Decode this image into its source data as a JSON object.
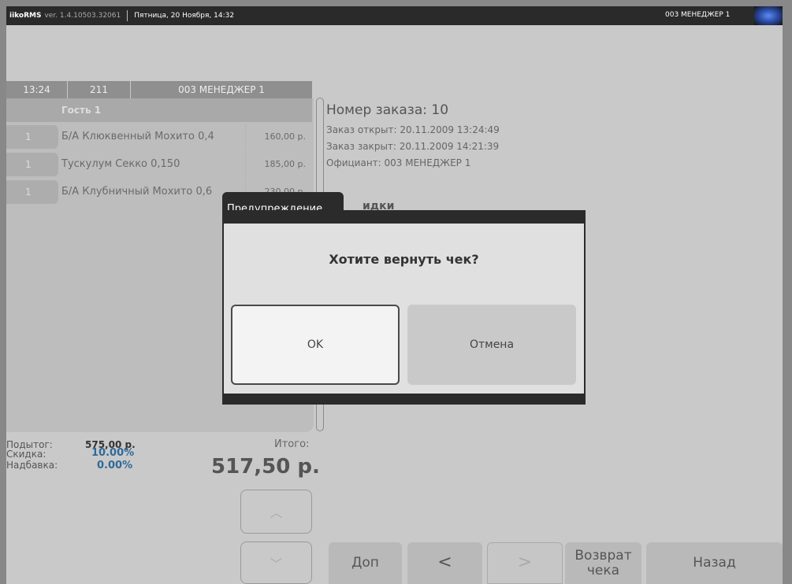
{
  "titlebar": {
    "brand": "iikoRMS",
    "version": "ver. 1.4.10503.32061",
    "datetime": "Пятница, 20 Ноября, 14:32",
    "user": "003 МЕНЕДЖЕР 1"
  },
  "order": {
    "time": "13:24",
    "table": "211",
    "waiter": "003 МЕНЕДЖЕР 1",
    "guest": "Гость 1",
    "items": [
      {
        "qty": "1",
        "name": "Б/А Клюквенный Мохито 0,4",
        "price": "160,00 р."
      },
      {
        "qty": "1",
        "name": "Тускулум Секко 0,150",
        "price": "185,00 р."
      },
      {
        "qty": "1",
        "name": "Б/А Клубничный Мохито 0,6",
        "price": "230,00 р."
      }
    ]
  },
  "info": {
    "title": "Номер заказа: 10",
    "opened": "Заказ открыт: 20.11.2009 13:24:49",
    "closed": "Заказ закрыт: 20.11.2009 14:21:39",
    "waiter": "Официант: 003 МЕНЕДЖЕР 1",
    "partial_text": "идки"
  },
  "totals": {
    "subtotal_label": "Подытог:",
    "subtotal_value": "575,00 р.",
    "discount_label": "Скидка:",
    "discount_value": "10.00%",
    "surcharge_label": "Надбавка:",
    "surcharge_value": "0.00%",
    "total_label": "Итого:",
    "total_value": "517,50 р."
  },
  "scroll": {
    "up": "︿",
    "down": "﹀"
  },
  "bottom": {
    "extra": "Доп",
    "prev": "<",
    "next": ">",
    "return_check": "Возврат чека",
    "back": "Назад"
  },
  "dialog": {
    "title": "Предупреждение",
    "message": "Хотите вернуть чек?",
    "ok": "OK",
    "cancel": "Отмена"
  },
  "colors": {
    "discount": "#2f6a9a",
    "dialog_frame": "#2b2b2b"
  }
}
